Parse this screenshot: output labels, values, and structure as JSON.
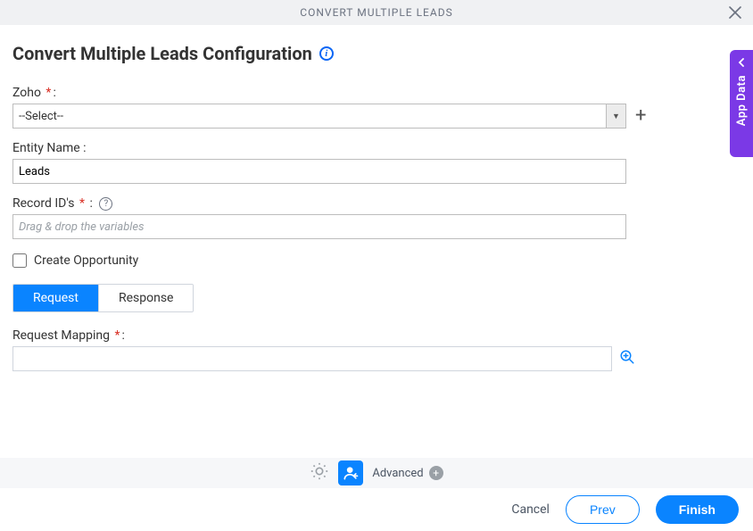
{
  "titlebar": {
    "title": "CONVERT MULTIPLE LEADS"
  },
  "page": {
    "heading": "Convert Multiple Leads Configuration"
  },
  "form": {
    "zoho": {
      "label": "Zoho",
      "selected": "--Select--"
    },
    "entity": {
      "label": "Entity Name :",
      "value": "Leads"
    },
    "record_ids": {
      "label": "Record ID's",
      "placeholder": "Drag & drop the variables"
    },
    "create_opp": {
      "label": "Create Opportunity"
    }
  },
  "tabs": {
    "request": "Request",
    "response": "Response",
    "active": "request"
  },
  "mapping": {
    "label": "Request Mapping"
  },
  "footer": {
    "advanced": "Advanced"
  },
  "actions": {
    "cancel": "Cancel",
    "prev": "Prev",
    "finish": "Finish"
  },
  "rail": {
    "label": "App Data"
  },
  "colors": {
    "primary": "#0a84ff",
    "rail": "#7b39e6"
  }
}
